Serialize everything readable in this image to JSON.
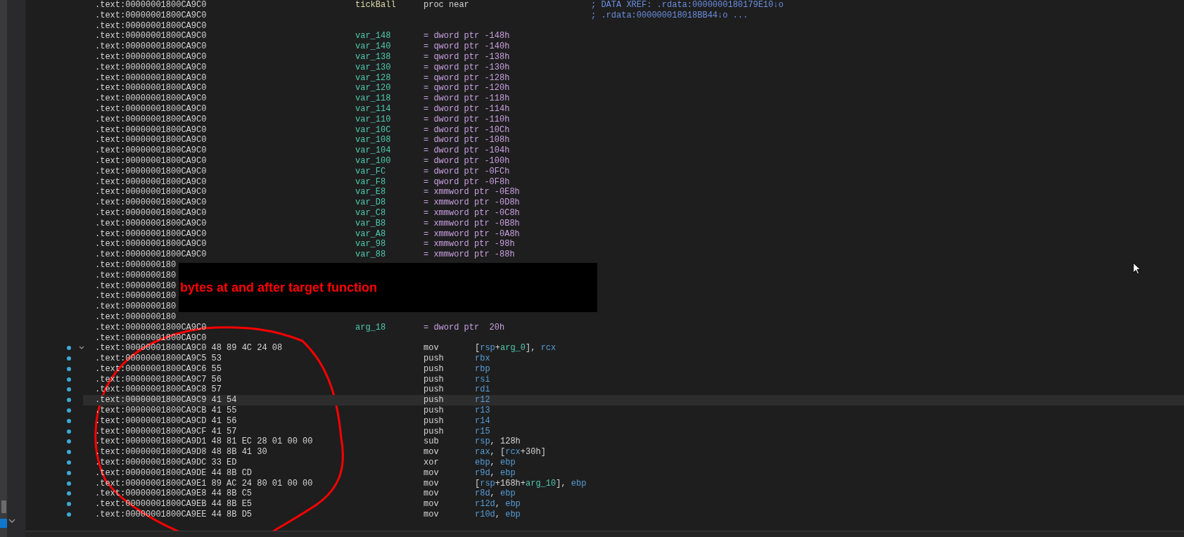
{
  "listing": {
    "rows": [
      {
        "kind": "proc",
        "address": ".text:00000001800CA9C0",
        "name": "tickBall",
        "directive": "proc near",
        "comment": "; DATA XREF: .rdata:0000000180179E10↓o"
      },
      {
        "kind": "blank",
        "address": ".text:00000001800CA9C0",
        "comment": "; .rdata:000000018018BB44↓o ..."
      },
      {
        "kind": "blank",
        "address": ".text:00000001800CA9C0"
      },
      {
        "kind": "var",
        "address": ".text:00000001800CA9C0",
        "name": "var_148",
        "directive": "= dword ptr -148h"
      },
      {
        "kind": "var",
        "address": ".text:00000001800CA9C0",
        "name": "var_140",
        "directive": "= qword ptr -140h"
      },
      {
        "kind": "var",
        "address": ".text:00000001800CA9C0",
        "name": "var_138",
        "directive": "= qword ptr -138h"
      },
      {
        "kind": "var",
        "address": ".text:00000001800CA9C0",
        "name": "var_130",
        "directive": "= qword ptr -130h"
      },
      {
        "kind": "var",
        "address": ".text:00000001800CA9C0",
        "name": "var_128",
        "directive": "= qword ptr -128h"
      },
      {
        "kind": "var",
        "address": ".text:00000001800CA9C0",
        "name": "var_120",
        "directive": "= qword ptr -120h"
      },
      {
        "kind": "var",
        "address": ".text:00000001800CA9C0",
        "name": "var_118",
        "directive": "= dword ptr -118h"
      },
      {
        "kind": "var",
        "address": ".text:00000001800CA9C0",
        "name": "var_114",
        "directive": "= dword ptr -114h"
      },
      {
        "kind": "var",
        "address": ".text:00000001800CA9C0",
        "name": "var_110",
        "directive": "= dword ptr -110h"
      },
      {
        "kind": "var",
        "address": ".text:00000001800CA9C0",
        "name": "var_10C",
        "directive": "= dword ptr -10Ch"
      },
      {
        "kind": "var",
        "address": ".text:00000001800CA9C0",
        "name": "var_108",
        "directive": "= dword ptr -108h"
      },
      {
        "kind": "var",
        "address": ".text:00000001800CA9C0",
        "name": "var_104",
        "directive": "= dword ptr -104h"
      },
      {
        "kind": "var",
        "address": ".text:00000001800CA9C0",
        "name": "var_100",
        "directive": "= dword ptr -100h"
      },
      {
        "kind": "var",
        "address": ".text:00000001800CA9C0",
        "name": "var_FC",
        "directive": "= dword ptr -0FCh"
      },
      {
        "kind": "var",
        "address": ".text:00000001800CA9C0",
        "name": "var_F8",
        "directive": "= qword ptr -0F8h"
      },
      {
        "kind": "var",
        "address": ".text:00000001800CA9C0",
        "name": "var_E8",
        "directive": "= xmmword ptr -0E8h"
      },
      {
        "kind": "var",
        "address": ".text:00000001800CA9C0",
        "name": "var_D8",
        "directive": "= xmmword ptr -0D8h"
      },
      {
        "kind": "var",
        "address": ".text:00000001800CA9C0",
        "name": "var_C8",
        "directive": "= xmmword ptr -0C8h"
      },
      {
        "kind": "var",
        "address": ".text:00000001800CA9C0",
        "name": "var_B8",
        "directive": "= xmmword ptr -0B8h"
      },
      {
        "kind": "var",
        "address": ".text:00000001800CA9C0",
        "name": "var_A8",
        "directive": "= xmmword ptr -0A8h"
      },
      {
        "kind": "var",
        "address": ".text:00000001800CA9C0",
        "name": "var_98",
        "directive": "= xmmword ptr -98h"
      },
      {
        "kind": "var",
        "address": ".text:00000001800CA9C0",
        "name": "var_88",
        "directive": "= xmmword ptr -88h"
      },
      {
        "kind": "covered",
        "address": ".text:0000000180"
      },
      {
        "kind": "covered",
        "address": ".text:0000000180"
      },
      {
        "kind": "covered",
        "address": ".text:0000000180"
      },
      {
        "kind": "covered",
        "address": ".text:0000000180"
      },
      {
        "kind": "covered",
        "address": ".text:0000000180"
      },
      {
        "kind": "covered",
        "address": ".text:0000000180"
      },
      {
        "kind": "var",
        "address": ".text:00000001800CA9C0",
        "name": "arg_18",
        "directive": "= dword ptr  20h"
      },
      {
        "kind": "blank",
        "address": ".text:00000001800CA9C0"
      },
      {
        "kind": "code",
        "address": ".text:00000001800CA9C0",
        "bytes": "48 89 4C 24 08",
        "mnemonic": "mov",
        "marked": true,
        "selected": false,
        "expanded": true,
        "operands": [
          {
            "kind": "plain",
            "text": "["
          },
          {
            "kind": "reg",
            "text": "rsp"
          },
          {
            "kind": "plain",
            "text": "+"
          },
          {
            "kind": "var",
            "text": "arg_0"
          },
          {
            "kind": "plain",
            "text": "], "
          },
          {
            "kind": "reg",
            "text": "rcx"
          }
        ]
      },
      {
        "kind": "code",
        "address": ".text:00000001800CA9C5",
        "bytes": "53",
        "mnemonic": "push",
        "marked": true,
        "selected": false,
        "operands": [
          {
            "kind": "reg",
            "text": "rbx"
          }
        ]
      },
      {
        "kind": "code",
        "address": ".text:00000001800CA9C6",
        "bytes": "55",
        "mnemonic": "push",
        "marked": true,
        "selected": false,
        "operands": [
          {
            "kind": "reg",
            "text": "rbp"
          }
        ]
      },
      {
        "kind": "code",
        "address": ".text:00000001800CA9C7",
        "bytes": "56",
        "mnemonic": "push",
        "marked": true,
        "selected": false,
        "operands": [
          {
            "kind": "reg",
            "text": "rsi"
          }
        ]
      },
      {
        "kind": "code",
        "address": ".text:00000001800CA9C8",
        "bytes": "57",
        "mnemonic": "push",
        "marked": true,
        "selected": false,
        "operands": [
          {
            "kind": "reg",
            "text": "rdi"
          }
        ]
      },
      {
        "kind": "code",
        "address": ".text:00000001800CA9C9",
        "bytes": "41 54",
        "mnemonic": "push",
        "marked": true,
        "selected": true,
        "operands": [
          {
            "kind": "reg",
            "text": "r12"
          }
        ]
      },
      {
        "kind": "code",
        "address": ".text:00000001800CA9CB",
        "bytes": "41 55",
        "mnemonic": "push",
        "marked": true,
        "selected": false,
        "operands": [
          {
            "kind": "reg",
            "text": "r13"
          }
        ]
      },
      {
        "kind": "code",
        "address": ".text:00000001800CA9CD",
        "bytes": "41 56",
        "mnemonic": "push",
        "marked": true,
        "selected": false,
        "operands": [
          {
            "kind": "reg",
            "text": "r14"
          }
        ]
      },
      {
        "kind": "code",
        "address": ".text:00000001800CA9CF",
        "bytes": "41 57",
        "mnemonic": "push",
        "marked": true,
        "selected": false,
        "operands": [
          {
            "kind": "reg",
            "text": "r15"
          }
        ]
      },
      {
        "kind": "code",
        "address": ".text:00000001800CA9D1",
        "bytes": "48 81 EC 28 01 00 00",
        "mnemonic": "sub",
        "marked": true,
        "selected": false,
        "operands": [
          {
            "kind": "reg",
            "text": "rsp"
          },
          {
            "kind": "plain",
            "text": ", 128h"
          }
        ]
      },
      {
        "kind": "code",
        "address": ".text:00000001800CA9D8",
        "bytes": "48 8B 41 30",
        "mnemonic": "mov",
        "marked": true,
        "selected": false,
        "operands": [
          {
            "kind": "reg",
            "text": "rax"
          },
          {
            "kind": "plain",
            "text": ", ["
          },
          {
            "kind": "reg",
            "text": "rcx"
          },
          {
            "kind": "plain",
            "text": "+30h]"
          }
        ]
      },
      {
        "kind": "code",
        "address": ".text:00000001800CA9DC",
        "bytes": "33 ED",
        "mnemonic": "xor",
        "marked": true,
        "selected": false,
        "operands": [
          {
            "kind": "reg",
            "text": "ebp"
          },
          {
            "kind": "plain",
            "text": ", "
          },
          {
            "kind": "reg",
            "text": "ebp"
          }
        ]
      },
      {
        "kind": "code",
        "address": ".text:00000001800CA9DE",
        "bytes": "44 8B CD",
        "mnemonic": "mov",
        "marked": true,
        "selected": false,
        "operands": [
          {
            "kind": "reg",
            "text": "r9d"
          },
          {
            "kind": "plain",
            "text": ", "
          },
          {
            "kind": "reg",
            "text": "ebp"
          }
        ]
      },
      {
        "kind": "code",
        "address": ".text:00000001800CA9E1",
        "bytes": "89 AC 24 80 01 00 00",
        "mnemonic": "mov",
        "marked": true,
        "selected": false,
        "operands": [
          {
            "kind": "plain",
            "text": "["
          },
          {
            "kind": "reg",
            "text": "rsp"
          },
          {
            "kind": "plain",
            "text": "+168h+"
          },
          {
            "kind": "var",
            "text": "arg_10"
          },
          {
            "kind": "plain",
            "text": "], "
          },
          {
            "kind": "reg",
            "text": "ebp"
          }
        ]
      },
      {
        "kind": "code",
        "address": ".text:00000001800CA9E8",
        "bytes": "44 8B C5",
        "mnemonic": "mov",
        "marked": true,
        "selected": false,
        "operands": [
          {
            "kind": "reg",
            "text": "r8d"
          },
          {
            "kind": "plain",
            "text": ", "
          },
          {
            "kind": "reg",
            "text": "ebp"
          }
        ]
      },
      {
        "kind": "code",
        "address": ".text:00000001800CA9EB",
        "bytes": "44 8B E5",
        "mnemonic": "mov",
        "marked": true,
        "selected": false,
        "operands": [
          {
            "kind": "reg",
            "text": "r12d"
          },
          {
            "kind": "plain",
            "text": ", "
          },
          {
            "kind": "reg",
            "text": "ebp"
          }
        ]
      },
      {
        "kind": "code",
        "address": ".text:00000001800CA9EE",
        "bytes": "44 8B D5",
        "mnemonic": "mov",
        "marked": true,
        "selected": false,
        "operands": [
          {
            "kind": "reg",
            "text": "r10d"
          },
          {
            "kind": "plain",
            "text": ", "
          },
          {
            "kind": "reg",
            "text": "ebp"
          }
        ]
      }
    ]
  },
  "annotation": {
    "text": "bytes at and after target function"
  }
}
